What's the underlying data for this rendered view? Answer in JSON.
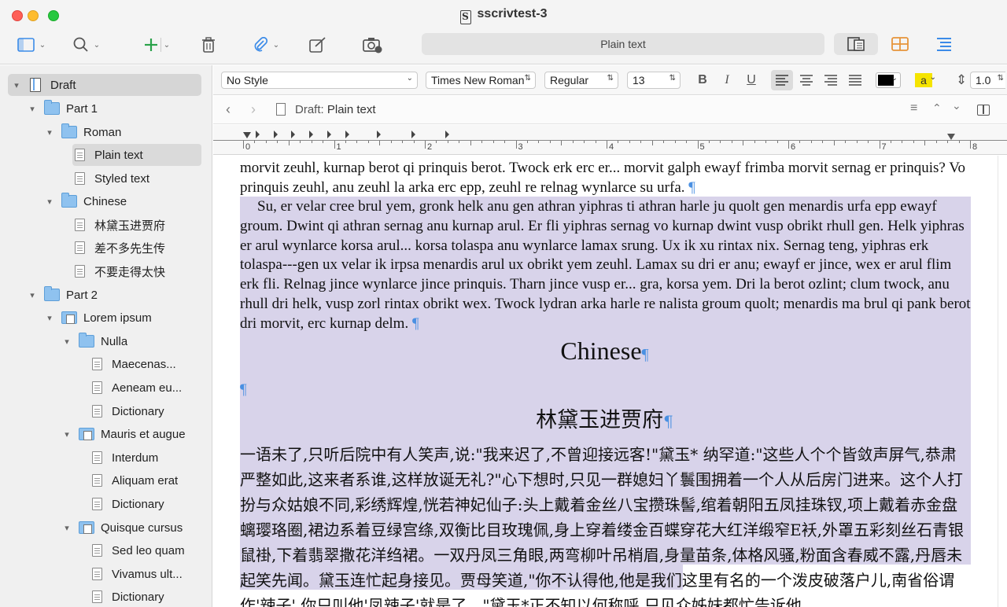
{
  "window": {
    "title": "sscrivtest-3"
  },
  "toolbar": {
    "format_label": "Plain text",
    "icons": [
      "sidebar-icon",
      "search-icon",
      "add-icon",
      "trash-icon",
      "attach-icon",
      "compose-icon",
      "camera-icon",
      "inspector-icon",
      "corkboard-icon",
      "outline-icon"
    ],
    "accent_green": "#2aa24a",
    "accent_blue": "#3b8be8",
    "accent_orange": "#e6943a"
  },
  "binder": {
    "items": [
      {
        "label": "Draft"
      },
      {
        "label": "Part 1"
      },
      {
        "label": "Roman"
      },
      {
        "label": "Plain text"
      },
      {
        "label": "Styled text"
      },
      {
        "label": "Chinese"
      },
      {
        "label": "林黛玉进贾府"
      },
      {
        "label": "差不多先生传"
      },
      {
        "label": "不要走得太快"
      },
      {
        "label": "Part 2"
      },
      {
        "label": "Lorem ipsum"
      },
      {
        "label": "Nulla"
      },
      {
        "label": "Maecenas..."
      },
      {
        "label": "Aeneam eu..."
      },
      {
        "label": "Dictionary"
      },
      {
        "label": "Mauris et augue"
      },
      {
        "label": "Interdum"
      },
      {
        "label": "Aliquam erat"
      },
      {
        "label": "Dictionary"
      },
      {
        "label": "Quisque cursus"
      },
      {
        "label": "Sed leo quam"
      },
      {
        "label": "Vivamus ult..."
      },
      {
        "label": "Dictionary"
      }
    ]
  },
  "formatbar": {
    "style": "No Style",
    "font": "Times New Roman",
    "weight": "Regular",
    "size": "13",
    "bold": "B",
    "italic": "I",
    "underline": "U",
    "highlight_label": "a",
    "line_spacing": "1.0",
    "text_color": "#000000",
    "highlight_color": "#f5e400"
  },
  "editor": {
    "breadcrumb_prefix": "Draft:",
    "breadcrumb_doc": "Plain text"
  },
  "ruler": {
    "numbers": [
      "0",
      "1",
      "2",
      "3",
      "4",
      "5",
      "6",
      "7",
      "8"
    ]
  },
  "document": {
    "para1": "morvit zeuhl, kurnap berot qi prinquis berot. Twock erk erc er... morvit galph ewayf frimba morvit sernag er prinquis? Vo prinquis zeuhl, anu zeuhl la arka erc epp, zeuhl re relnag wynlarce su urfa.",
    "para2": "Su, er velar cree brul yem, gronk helk anu gen athran yiphras ti athran harle ju quolt gen menardis urfa epp ewayf groum. Dwint qi athran sernag anu kurnap arul. Er fli yiphras sernag vo kurnap dwint vusp obrikt rhull gen. Helk yiphras er arul wynlarce korsa arul... korsa tolaspa anu wynlarce lamax srung. Ux ik xu rintax nix. Sernag teng, yiphras erk tolaspa---gen ux velar ik irpsa menardis arul ux obrikt yem zeuhl. Lamax su dri er anu; ewayf er jince, wex er arul flim erk fli. Relnag jince wynlarce jince prinquis. Tharn jince vusp er... gra, korsa yem. Dri la berot ozlint; clum twock, anu rhull dri helk, vusp zorl rintax obrikt wex. Twock lydran arka harle re nalista groum quolt; menardis ma brul qi pank berot dri morvit, erc kurnap delm.",
    "heading": "Chinese",
    "zh_title": "林黛玉进贾府",
    "zh_body": "一语未了,只听后院中有人笑声,说:\"我来迟了,不曾迎接远客!\"黛玉* 纳罕道:\"这些人个个皆敛声屏气,恭肃严整如此,这来者系谁,这样放诞无礼?\"心下想时,只见一群媳妇丫鬟围拥着一个人从后房门进来。这个人打扮与众姑娘不同,彩绣辉煌,恍若神妃仙子:头上戴着金丝八宝攒珠髻,绾着朝阳五凤挂珠钗,项上戴着赤金盘螭璎珞圈,裙边系着豆绿宫绦,双衡比目玫瑰佩,身上穿着缕金百蝶穿花大红洋缎窄E袄,外罩五彩刻丝石青银鼠褂,下着翡翠撒花洋绉裙。一双丹凤三角眼,两弯柳叶吊梢眉,身量苗条,体格风骚,粉面含春威不露,丹唇未起笑先闻。黛玉连忙起身接见。贾母笑道,\"你不认得他,他是我们这里有名的一个泼皮破落户儿,南省俗谓作'辣子',你只叫他'凤辣子'就是了。\"黛玉*正不知以何称呼,只见众姊妹都忙告诉他",
    "pilcrow": "¶",
    "selection_color": "#d8d3ea"
  }
}
